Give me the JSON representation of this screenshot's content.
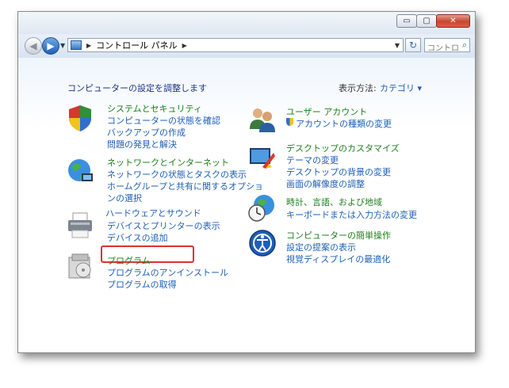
{
  "window": {
    "caption": {
      "minimize": "▭",
      "maximize": "▢",
      "close": "✕"
    }
  },
  "navbar": {
    "back_glyph": "◀",
    "forward_glyph": "▶",
    "breadcrumb": [
      "コントロール パネル"
    ],
    "search_placeholder": "コントロ...",
    "refresh_glyph": "↻"
  },
  "main": {
    "heading": "コンピューターの設定を調整します",
    "view_by_label": "表示方法:",
    "view_by_value": "カテゴリ ▾"
  },
  "categories": {
    "system": {
      "icon": "shield-icon",
      "title": "システムとセキュリティ",
      "links": [
        "コンピューターの状態を確認",
        "バックアップの作成",
        "問題の発見と解決"
      ]
    },
    "network": {
      "icon": "network-globe-icon",
      "title": "ネットワークとインターネット",
      "links": [
        "ネットワークの状態とタスクの表示",
        "ホームグループと共有に関するオプショ",
        "ンの選択"
      ]
    },
    "hardware": {
      "icon": "printer-icon",
      "title": "ハードウェアとサウンド",
      "links": [
        "デバイスとプリンターの表示",
        "デバイスの追加"
      ]
    },
    "programs": {
      "icon": "programs-box-icon",
      "title": "プログラム",
      "links": [
        "プログラムのアンインストール",
        "プログラムの取得"
      ]
    },
    "users": {
      "icon": "users-icon",
      "title": "ユーザー アカウント",
      "links": [
        "アカウントの種類の変更"
      ]
    },
    "appearance": {
      "icon": "desktop-icon",
      "title": "デスクトップのカスタマイズ",
      "links": [
        "テーマの変更",
        "デスクトップの背景の変更",
        "画面の解像度の調整"
      ]
    },
    "clock": {
      "icon": "clock-globe-icon",
      "title": "時計、言語、および地域",
      "links": [
        "キーボードまたは入力方法の変更"
      ]
    },
    "ease": {
      "icon": "ease-of-access-icon",
      "title": "コンピューターの簡単操作",
      "links": [
        "設定の提案の表示",
        "視覚ディスプレイの最適化"
      ]
    }
  },
  "colors": {
    "link": "#1e5fb5",
    "category_title": "#1e7e1e",
    "highlight": "#e03030"
  }
}
